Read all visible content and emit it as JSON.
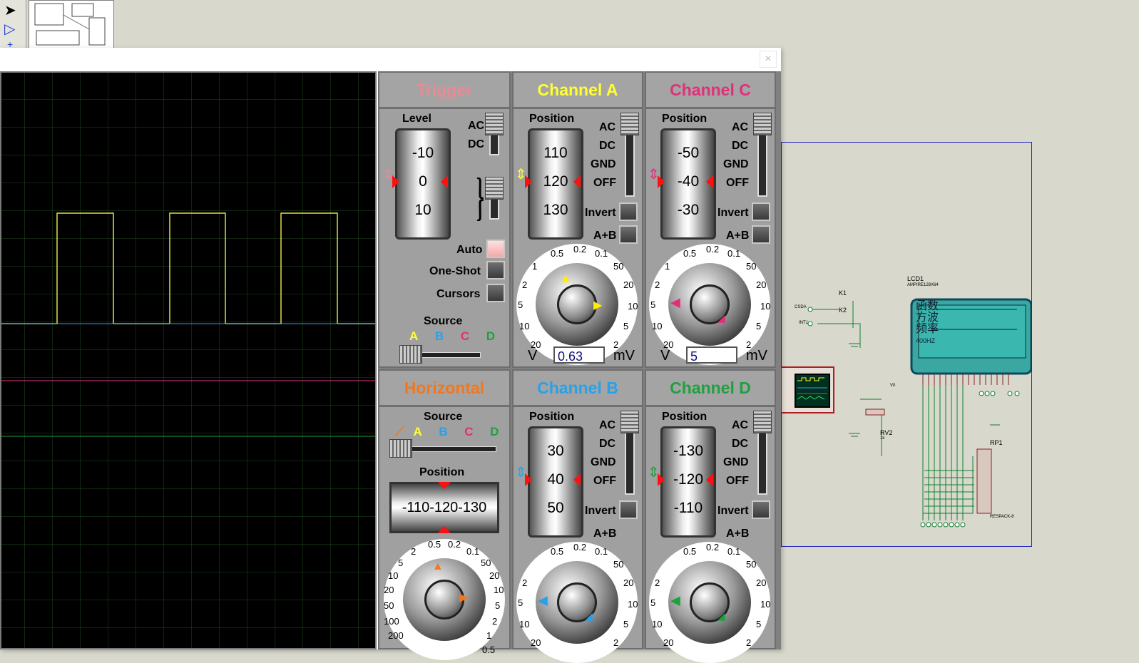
{
  "trigger": {
    "title": "Trigger",
    "level_label": "Level",
    "ac": "AC",
    "dc": "DC",
    "drum": [
      "-10",
      "0",
      "10"
    ],
    "auto": "Auto",
    "one_shot": "One-Shot",
    "cursors": "Cursors",
    "source_label": "Source",
    "sources": [
      "A",
      "B",
      "C",
      "D"
    ],
    "color": "#e98a96"
  },
  "channel_a": {
    "title": "Channel A",
    "color": "#ffff33",
    "position_label": "Position",
    "drum": [
      "110",
      "120",
      "130"
    ],
    "modes": [
      "AC",
      "DC",
      "GND",
      "OFF"
    ],
    "invert": "Invert",
    "ab": "A+B",
    "ticks": [
      "0.5",
      "0.2",
      "0.1",
      "50",
      "20",
      "10",
      "5",
      "2",
      "20",
      "10",
      "5",
      "2",
      "1"
    ],
    "unit_left": "V",
    "unit_right": "mV",
    "value": "0.63"
  },
  "channel_c": {
    "title": "Channel C",
    "color": "#e0307a",
    "position_label": "Position",
    "drum": [
      "-50",
      "-40",
      "-30"
    ],
    "modes": [
      "AC",
      "DC",
      "GND",
      "OFF"
    ],
    "invert": "Invert",
    "ab": "A+B",
    "ticks": [
      "0.5",
      "0.2",
      "0.1",
      "50",
      "20",
      "10",
      "5",
      "2",
      "20",
      "10",
      "5",
      "2",
      "1"
    ],
    "unit_left": "V",
    "unit_right": "mV",
    "value": "5"
  },
  "horizontal": {
    "title": "Horizontal",
    "color": "#f07820",
    "source_label": "Source",
    "sources": [
      "A",
      "B",
      "C",
      "D"
    ],
    "position_label": "Position",
    "drum": "-110-120-130",
    "ticks": [
      "0.5",
      "0.2",
      "0.1",
      "50",
      "20",
      "10",
      "5",
      "2",
      "1",
      "0.5",
      "2",
      "5",
      "10",
      "20",
      "50",
      "100",
      "200"
    ]
  },
  "channel_b": {
    "title": "Channel B",
    "color": "#2aa0e8",
    "position_label": "Position",
    "drum": [
      "30",
      "40",
      "50"
    ],
    "modes": [
      "AC",
      "DC",
      "GND",
      "OFF"
    ],
    "invert": "Invert",
    "ab": "A+B",
    "ticks": [
      "0.5",
      "0.2",
      "0.1",
      "50",
      "20",
      "10",
      "5",
      "2",
      "20",
      "10",
      "5",
      "2"
    ]
  },
  "channel_d": {
    "title": "Channel D",
    "color": "#20a040",
    "position_label": "Position",
    "drum": [
      "-130",
      "-120",
      "-110"
    ],
    "modes": [
      "AC",
      "DC",
      "GND",
      "OFF"
    ],
    "invert": "Invert",
    "ab": "A+B",
    "ticks": [
      "0.5",
      "0.2",
      "0.1",
      "50",
      "20",
      "10",
      "5",
      "2",
      "20",
      "10",
      "5",
      "2"
    ]
  },
  "schematic": {
    "lcd_label": "LCD1",
    "lcd_part": "AMPIRE128X64",
    "lcd_lines": [
      "函数",
      "方波",
      "频率",
      "400HZ"
    ],
    "k1": "K1",
    "k2": "K2",
    "csda": "CSDA",
    "int1": "INT1",
    "rv2": "RV2",
    "rv2_value": "1k",
    "rp1": "RP1",
    "rp1_part": "RESPACK-8",
    "v0": "V0"
  },
  "close_glyph": "×"
}
